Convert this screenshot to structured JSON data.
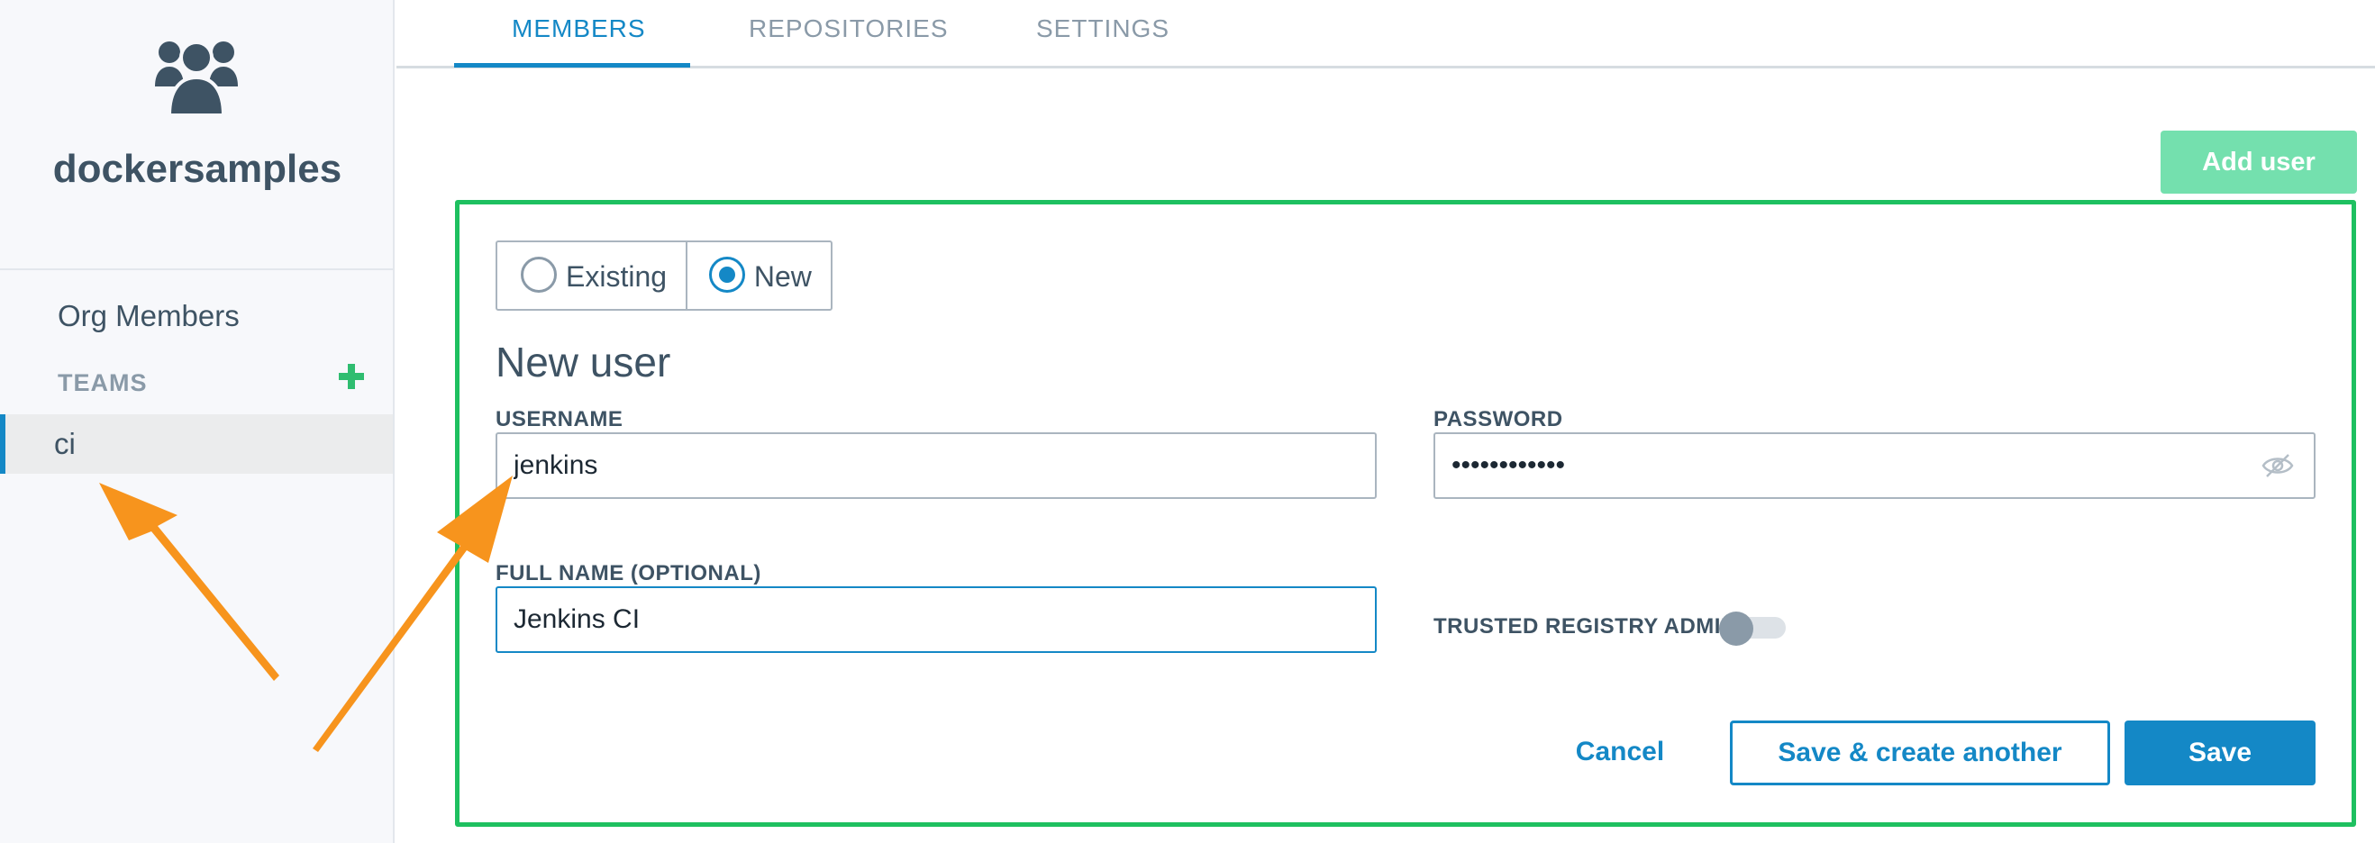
{
  "sidebar": {
    "org_icon": "users-group-icon",
    "org_name": "dockersamples",
    "org_members_label": "Org Members",
    "teams_label": "TEAMS",
    "teams_add_icon": "plus-icon",
    "teams": [
      {
        "label": "ci",
        "selected": true
      }
    ]
  },
  "tabs": [
    {
      "label": "MEMBERS",
      "active": true
    },
    {
      "label": "REPOSITORIES",
      "active": false
    },
    {
      "label": "SETTINGS",
      "active": false
    }
  ],
  "add_user_label": "Add user",
  "form": {
    "mode_options": [
      {
        "label": "Existing",
        "selected": false
      },
      {
        "label": "New",
        "selected": true
      }
    ],
    "title": "New user",
    "username_label": "USERNAME",
    "username_value": "jenkins",
    "password_label": "PASSWORD",
    "password_value": "••••••••••••",
    "password_visibility_icon": "eye-slash-icon",
    "fullname_label": "FULL NAME (OPTIONAL)",
    "fullname_value": "Jenkins CI",
    "trusted_admin_label": "TRUSTED REGISTRY ADMIN",
    "trusted_admin_enabled": false,
    "cancel_label": "Cancel",
    "save_another_label": "Save & create another",
    "save_label": "Save"
  },
  "colors": {
    "accent_blue": "#1488c6",
    "highlight_green": "#1ec060",
    "add_user_green": "#74e0ae",
    "annotation_orange": "#f7941d",
    "text_dark": "#3e5364"
  }
}
